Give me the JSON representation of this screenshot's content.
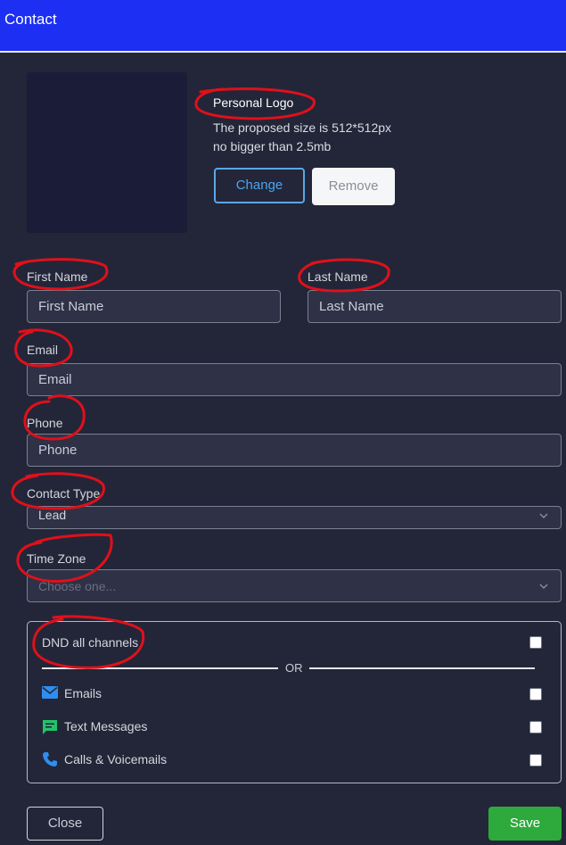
{
  "header": {
    "title": "Contact"
  },
  "logo": {
    "title": "Personal Logo",
    "desc_line1": "The proposed size is 512*512px",
    "desc_line2": "no bigger than 2.5mb",
    "change_label": "Change",
    "remove_label": "Remove"
  },
  "form": {
    "first_name_label": "First Name",
    "first_name_placeholder": "First Name",
    "last_name_label": "Last Name",
    "last_name_placeholder": "Last Name",
    "email_label": "Email",
    "email_placeholder": "Email",
    "phone_label": "Phone",
    "phone_placeholder": "Phone",
    "contact_type_label": "Contact Type",
    "contact_type_value": "Lead",
    "time_zone_label": "Time Zone",
    "time_zone_placeholder": "Choose one..."
  },
  "dnd": {
    "all_label": "DND all channels",
    "or_text": "OR",
    "emails_label": "Emails",
    "text_messages_label": "Text Messages",
    "calls_label": "Calls & Voicemails"
  },
  "footer": {
    "close_label": "Close",
    "save_label": "Save"
  },
  "colors": {
    "header_bg": "#1c2ff2",
    "page_bg": "#232638",
    "accent_blue": "#4da3ef",
    "save_green": "#2eaa3c",
    "annotation_red": "#e0101a",
    "email_icon": "#2f8df0",
    "sms_icon": "#22c46b",
    "phone_icon": "#2f8df0"
  },
  "icons": {
    "emails": "envelope-icon",
    "text_messages": "chat-bubble-icon",
    "calls": "phone-icon",
    "select": "chevron-down-icon"
  }
}
